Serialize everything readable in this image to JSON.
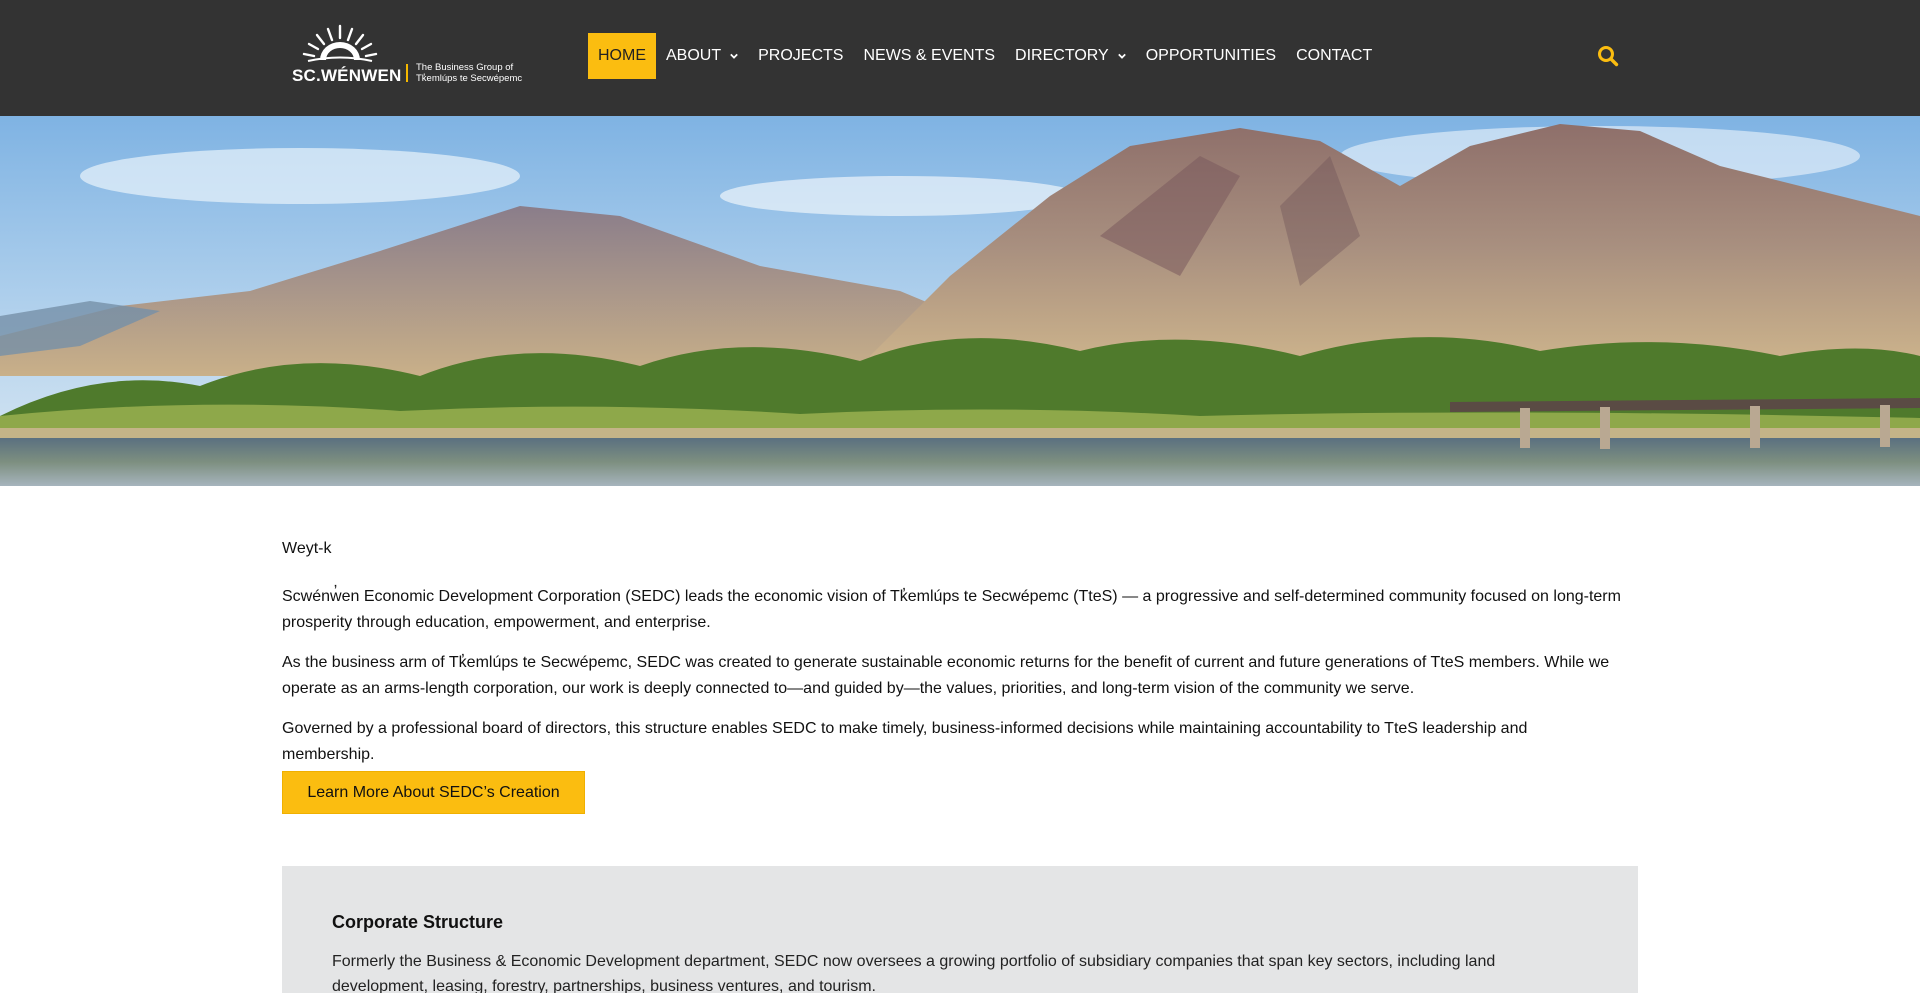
{
  "brand": {
    "wordmark": "SC.WÉNWEN",
    "tagline_line1": "The Business Group of",
    "tagline_line2": "Tk̓emlúps te Secwépemc",
    "accent_color": "#fbbd10",
    "header_bg": "#333333"
  },
  "nav": {
    "items": [
      {
        "label": "HOME",
        "active": true
      },
      {
        "label": "ABOUT",
        "dropdown": true
      },
      {
        "label": "PROJECTS"
      },
      {
        "label": "NEWS & EVENTS"
      },
      {
        "label": "DIRECTORY",
        "dropdown": true
      },
      {
        "label": "OPPORTUNITIES"
      },
      {
        "label": "CONTACT"
      }
    ],
    "search_icon": "search-icon"
  },
  "main": {
    "greeting": "Weyt-k",
    "paragraphs": [
      "Scwénw̓en Economic Development Corporation (SEDC) leads the economic vision of Tk̓emlúps te Secwépemc (TteS) — a progressive and self-determined community focused on long-term prosperity through education, empowerment, and enterprise.",
      "As the business arm of Tk̓emlúps te Secwépemc, SEDC was created to generate sustainable economic returns for the benefit of current and future generations of TteS members. While we operate as an arms-length corporation, our work is deeply connected to—and guided by—the values, priorities, and long-term vision of the community we serve.",
      "Governed by a professional board of directors, this structure enables SEDC to make timely, business-informed decisions while maintaining accountability to TteS leadership and membership."
    ],
    "cta_label": "Learn More About SEDC’s Creation"
  },
  "corporate": {
    "title": "Corporate Structure",
    "text": "Formerly the Business & Economic Development department, SEDC now oversees a growing portfolio of subsidiary companies that span key sectors, including land development, leasing, forestry, partnerships, business ventures, and tourism."
  }
}
